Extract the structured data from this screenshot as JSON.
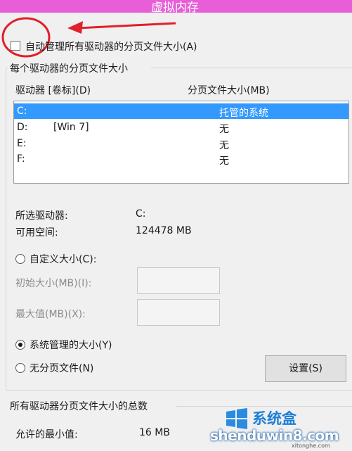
{
  "window": {
    "title": "虚拟内存"
  },
  "auto_manage": {
    "label": "自动管理所有驱动器的分页文件大小(A)",
    "checked": false
  },
  "per_drive": {
    "group_title": "每个驱动器的分页文件大小",
    "col_drive": "驱动器 [卷标](D)",
    "col_size": "分页文件大小(MB)",
    "rows": [
      {
        "drive": "C:",
        "label": "",
        "size": "托管的系统",
        "selected": true
      },
      {
        "drive": "D:",
        "label": "[Win 7]",
        "size": "无",
        "selected": false
      },
      {
        "drive": "E:",
        "label": "",
        "size": "无",
        "selected": false
      },
      {
        "drive": "F:",
        "label": "",
        "size": "无",
        "selected": false
      }
    ],
    "selected_drive_label": "所选驱动器:",
    "selected_drive_value": "C:",
    "free_space_label": "可用空间:",
    "free_space_value": "124478 MB",
    "custom_size_label": "自定义大小(C):",
    "initial_size_label": "初始大小(MB)(I):",
    "initial_size_value": "",
    "max_size_label": "最大值(MB)(X):",
    "max_size_value": "",
    "system_managed_label": "系统管理的大小(Y)",
    "no_paging_label": "无分页文件(N)",
    "set_button": "设置(S)"
  },
  "total": {
    "group_title": "所有驱动器分页文件大小的总数",
    "min_allowed_label": "允许的最小值:",
    "min_allowed_value": "16 MB"
  },
  "watermark": {
    "brand": "系统盒",
    "domain": "shenduwin8.com",
    "sub": "xitonghe.com"
  },
  "colors": {
    "titlebar": "#e85ed8",
    "selection": "#3399ff",
    "annotation": "#e0202a"
  }
}
